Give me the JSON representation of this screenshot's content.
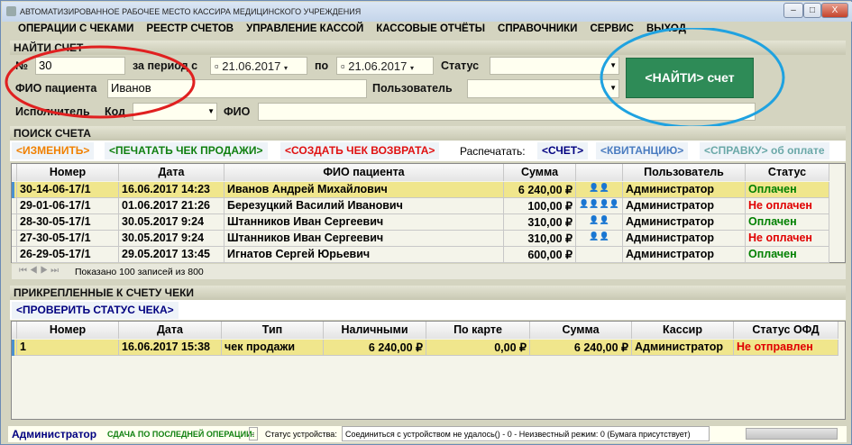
{
  "window": {
    "title": "АВТОМАТИЗИРОВАННОЕ РАБОЧЕЕ МЕСТО КАССИРА МЕДИЦИНСКОГО УЧРЕЖДЕНИЯ",
    "min": "–",
    "max": "□",
    "close": "X"
  },
  "menu": [
    "ОПЕРАЦИИ С ЧЕКАМИ",
    "РЕЕСТР СЧЕТОВ",
    "УПРАВЛЕНИЕ КАССОЙ",
    "КАССОВЫЕ ОТЧЁТЫ",
    "СПРАВОЧНИКИ",
    "СЕРВИС",
    "ВЫХОД"
  ],
  "find": {
    "title": "НАЙТИ СЧЕТ",
    "num_label": "№",
    "num_value": "30",
    "period_label": "за период с",
    "date_from": "21.06.2017",
    "to_label": "по",
    "date_to": "21.06.2017",
    "status_label": "Статус",
    "status_value": "",
    "patient_label": "ФИО пациента",
    "patient_value": "Иванов",
    "user_label": "Пользователь",
    "user_value": "",
    "executor_label": "Исполнитель",
    "code_label": "Код",
    "fio_label": "ФИО",
    "find_button": "<НАЙТИ> счет"
  },
  "search": {
    "title": "ПОИСК СЧЕТА",
    "actions": {
      "edit": "<ИЗМЕНИТЬ>",
      "print_sale": "<ПЕЧАТАТЬ ЧЕК ПРОДАЖИ>",
      "create_return": "<СОЗДАТЬ ЧЕК ВОЗВРАТА>",
      "print_label": "Распечатать:",
      "invoice": "<СЧЕТ>",
      "receipt": "<КВИТАНЦИЮ>",
      "certificate": "<СПРАВКУ> об оплате"
    },
    "columns": [
      "Номер",
      "Дата",
      "ФИО пациента",
      "Сумма",
      "",
      "Пользователь",
      "Статус"
    ],
    "rows": [
      [
        "30-14-06-17/1",
        "16.06.2017 14:23",
        "Иванов Андрей Михайлович",
        "6 240,00 ₽",
        "👤👤",
        "Администратор",
        "Оплачен"
      ],
      [
        "29-01-06-17/1",
        "01.06.2017 21:26",
        "Березуцкий Василий Иванович",
        "100,00 ₽",
        "👤👤👤👤",
        "Администратор",
        "Не оплачен"
      ],
      [
        "28-30-05-17/1",
        "30.05.2017 9:24",
        "Штанников Иван Сергеевич",
        "310,00 ₽",
        "👤👤",
        "Администратор",
        "Оплачен"
      ],
      [
        "27-30-05-17/1",
        "30.05.2017 9:24",
        "Штанников Иван Сергеевич",
        "310,00 ₽",
        "👤👤",
        "Администратор",
        "Не оплачен"
      ],
      [
        "26-29-05-17/1",
        "29.05.2017 13:45",
        "Игнатов Сергей Юрьевич",
        "600,00 ₽",
        "",
        "Администратор",
        "Оплачен"
      ]
    ],
    "pager": "Показано  100  записей из  800"
  },
  "checks": {
    "title": "ПРИКРЕПЛЕННЫЕ К СЧЕТУ ЧЕКИ",
    "check_status": "<ПРОВЕРИТЬ СТАТУС ЧЕКА>",
    "columns": [
      "Номер",
      "Дата",
      "Тип",
      "Наличными",
      "По карте",
      "Сумма",
      "Кассир",
      "Статус ОФД"
    ],
    "rows": [
      [
        "1",
        "16.06.2017 15:38",
        "чек продажи",
        "6 240,00 ₽",
        "0,00 ₽",
        "6 240,00 ₽",
        "Администратор",
        "Не отправлен"
      ]
    ]
  },
  "statusbar": {
    "user": "Администратор",
    "change_label": "СДАЧА ПО ПОСЛЕДНЕЙ ОПЕРАЦИИ:",
    "change_value": "-",
    "device_label": "Статус устройства:",
    "device_value": "Соединиться с устройством не удалось() - 0 - Неизвестный режим: 0 (Бумага присутствует)"
  },
  "colors": {
    "accent_green": "#2e8b57",
    "paid": "#008000",
    "unpaid": "#e00000",
    "selected": "#f0e68c"
  }
}
